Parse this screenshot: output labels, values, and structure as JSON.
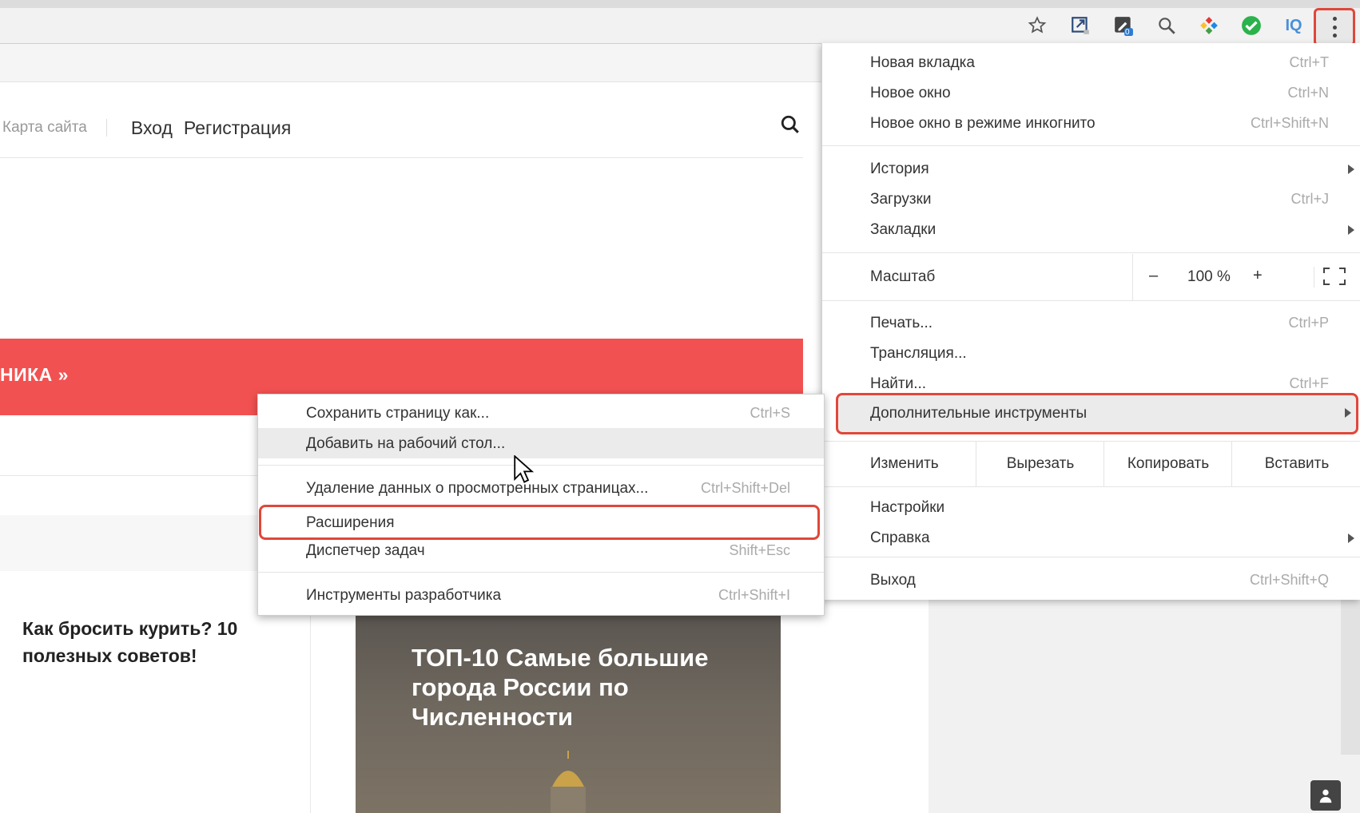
{
  "toolbar": {
    "icons": [
      "bookmark-star-icon",
      "ext-open-icon",
      "ext-pen-icon",
      "ext-search-icon",
      "ext-colorful-icon",
      "ext-check-icon",
      "ext-iq-icon"
    ],
    "badge_count": "0",
    "iq_label": "IQ"
  },
  "site": {
    "sitemap": "Карта сайта",
    "login": "Вход",
    "register": "Регистрация",
    "banner_text": "НИКА »",
    "article1_title": "Как бросить курить? 10 полезных советов!",
    "article2_title": "ТОП-10 Самые большие города России по Численности"
  },
  "main_menu": {
    "new_tab": {
      "label": "Новая вкладка",
      "shortcut": "Ctrl+T"
    },
    "new_window": {
      "label": "Новое окно",
      "shortcut": "Ctrl+N"
    },
    "incognito": {
      "label": "Новое окно в режиме инкогнито",
      "shortcut": "Ctrl+Shift+N"
    },
    "history": {
      "label": "История"
    },
    "downloads": {
      "label": "Загрузки",
      "shortcut": "Ctrl+J"
    },
    "bookmarks": {
      "label": "Закладки"
    },
    "zoom": {
      "label": "Масштаб",
      "minus": "–",
      "value": "100 %",
      "plus": "+"
    },
    "print": {
      "label": "Печать...",
      "shortcut": "Ctrl+P"
    },
    "cast": {
      "label": "Трансляция..."
    },
    "find": {
      "label": "Найти...",
      "shortcut": "Ctrl+F"
    },
    "more_tools": {
      "label": "Дополнительные инструменты"
    },
    "edit": {
      "label": "Изменить",
      "cut": "Вырезать",
      "copy": "Копировать",
      "paste": "Вставить"
    },
    "settings": {
      "label": "Настройки"
    },
    "help": {
      "label": "Справка"
    },
    "exit": {
      "label": "Выход",
      "shortcut": "Ctrl+Shift+Q"
    }
  },
  "sub_menu": {
    "save_page": {
      "label": "Сохранить страницу как...",
      "shortcut": "Ctrl+S"
    },
    "add_desktop": {
      "label": "Добавить на рабочий стол..."
    },
    "clear_data": {
      "label": "Удаление данных о просмотренных страницах...",
      "shortcut": "Ctrl+Shift+Del"
    },
    "extensions": {
      "label": "Расширения"
    },
    "task_manager": {
      "label": "Диспетчер задач",
      "shortcut": "Shift+Esc"
    },
    "dev_tools": {
      "label": "Инструменты разработчика",
      "shortcut": "Ctrl+Shift+I"
    }
  },
  "colors": {
    "highlight": "#e0473a",
    "banner": "#f25151"
  }
}
